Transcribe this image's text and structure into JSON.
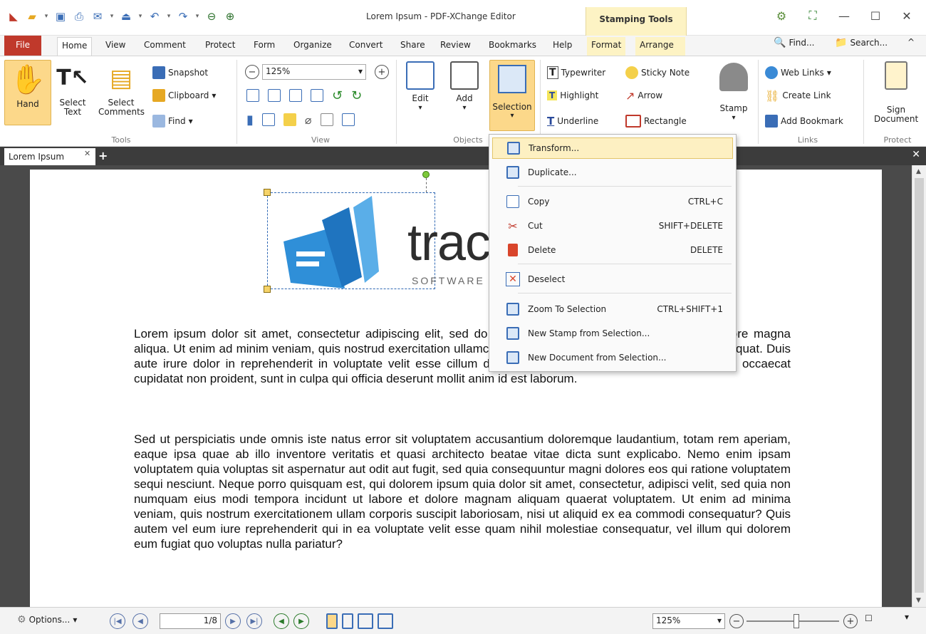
{
  "window": {
    "title": "Lorem Ipsum - PDF-XChange Editor",
    "contextual_tab_group": "Stamping Tools"
  },
  "ribbon_tabs": [
    "File",
    "Home",
    "View",
    "Comment",
    "Protect",
    "Form",
    "Organize",
    "Convert",
    "Share",
    "Review",
    "Bookmarks",
    "Help",
    "Format",
    "Arrange"
  ],
  "ribbon_right": {
    "find": "Find...",
    "search": "Search..."
  },
  "tools_group": {
    "label": "Tools",
    "hand": "Hand",
    "select_text": "Select Text",
    "select_comments": "Select Comments",
    "snapshot": "Snapshot",
    "clipboard": "Clipboard",
    "find": "Find"
  },
  "view_group": {
    "label": "View",
    "zoom": "125%"
  },
  "objects_group": {
    "label": "Objects",
    "edit": "Edit",
    "add": "Add",
    "selection": "Selection"
  },
  "comment_group": {
    "typewriter": "Typewriter",
    "sticky_note": "Sticky Note",
    "highlight": "Highlight",
    "arrow": "Arrow",
    "underline": "Underline",
    "rectangle": "Rectangle",
    "stamp": "Stamp"
  },
  "links_group": {
    "label": "Links",
    "web_links": "Web Links",
    "create_link": "Create Link",
    "add_bookmark": "Add Bookmark"
  },
  "protect_group": {
    "label": "Protect",
    "sign_document": "Sign Document"
  },
  "document_tab": {
    "label": "Lorem Ipsum"
  },
  "logo": {
    "word": "trac",
    "sub": "SOFTWARE"
  },
  "selection_menu": [
    {
      "label": "Transform...",
      "shortcut": ""
    },
    {
      "label": "Duplicate...",
      "shortcut": ""
    },
    {
      "label": "Copy",
      "shortcut": "CTRL+C"
    },
    {
      "label": "Cut",
      "shortcut": "SHIFT+DELETE"
    },
    {
      "label": "Delete",
      "shortcut": "DELETE"
    },
    {
      "label": "Deselect",
      "shortcut": ""
    },
    {
      "label": "Zoom To Selection",
      "shortcut": "CTRL+SHIFT+1"
    },
    {
      "label": "New Stamp from Selection...",
      "shortcut": ""
    },
    {
      "label": "New Document from Selection...",
      "shortcut": ""
    }
  ],
  "document_text": {
    "paragraph_1": "Lorem ipsum dolor sit amet, consectetur adipiscing elit, sed do eiusmod tempor incididunt ut labore et dolore magna aliqua. Ut enim ad minim veniam, quis nostrud exercitation ullamco laboris nisi ut aliquip ex ea commodo consequat. Duis aute irure dolor in reprehenderit in voluptate velit esse cillum dolore eu fugiat nulla pariatur. Excepteur sint occaecat cupidatat non proident, sunt in culpa qui officia deserunt mollit anim id est laborum.",
    "paragraph_2": "Sed ut perspiciatis unde omnis iste natus error sit voluptatem accusantium doloremque laudantium, totam rem aperiam, eaque ipsa quae ab illo inventore veritatis et quasi architecto beatae vitae dicta sunt explicabo. Nemo enim ipsam voluptatem quia voluptas sit aspernatur aut odit aut fugit, sed quia consequuntur magni dolores eos qui ratione voluptatem sequi nesciunt. Neque porro quisquam est, qui dolorem ipsum quia dolor sit amet, consectetur, adipisci velit, sed quia non numquam eius modi tempora incidunt ut labore et dolore magnam aliquam quaerat voluptatem. Ut enim ad minima veniam, quis nostrum exercitationem ullam corporis suscipit laboriosam, nisi ut aliquid ex ea commodi consequatur? Quis autem vel eum iure reprehenderit qui in ea voluptate velit esse quam nihil molestiae consequatur, vel illum qui dolorem eum fugiat quo voluptas nulla pariatur?"
  },
  "statusbar": {
    "options": "Options...",
    "page": "1/8",
    "zoom": "125%"
  },
  "colors": {
    "file_tab": "#c0392b",
    "accent": "#fcd88a",
    "contextual": "#fdf3c4",
    "logo_blue": "#2f8fd8"
  }
}
